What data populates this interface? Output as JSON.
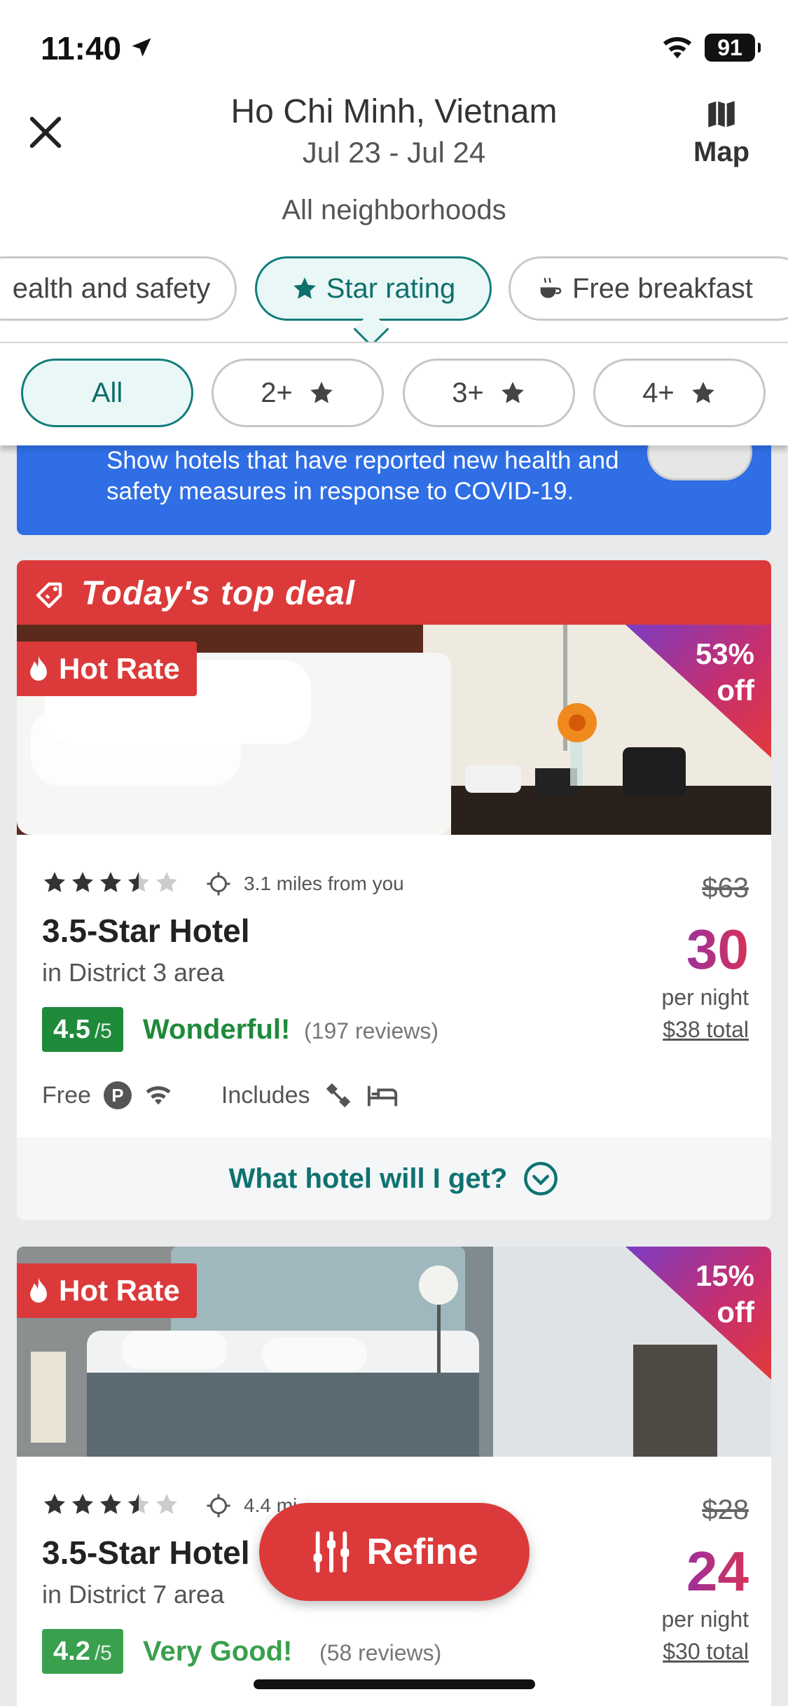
{
  "status_bar": {
    "time": "11:40",
    "battery": "91"
  },
  "header": {
    "destination": "Ho Chi Minh, Vietnam",
    "dates": "Jul 23 - Jul 24",
    "map_label": "Map",
    "neighborhoods": "All neighborhoods"
  },
  "filter_chips": [
    "ealth and safety",
    "Star rating",
    "Free breakfast"
  ],
  "star_filters": [
    {
      "label": "All"
    },
    {
      "label": "2+"
    },
    {
      "label": "3+"
    },
    {
      "label": "4+"
    }
  ],
  "covid_banner": {
    "text": "Show hotels that have reported new health and safety measures in response to COVID-19."
  },
  "top_deal_label": "Today's top deal",
  "hot_rate_label": "Hot Rate",
  "refine_label": "Refine",
  "what_hotel_label": "What hotel will I get?",
  "hotels": [
    {
      "discount": "53%",
      "off": "off",
      "stars": 3.5,
      "distance": "3.1 miles from you",
      "name": "3.5-Star Hotel",
      "area": "in District 3 area",
      "rating": "4.5",
      "rating_of": "/5",
      "verdict": "Wonderful!",
      "reviews": "(197 reviews)",
      "old_price": "$63",
      "currency": "$",
      "price": "30",
      "per_night": "per night",
      "total": "$38 total",
      "amenity_free": "Free",
      "amenity_includes": "Includes"
    },
    {
      "discount": "15%",
      "off": "off",
      "stars": 3.5,
      "distance": "4.4 mi",
      "name": "3.5-Star Hotel",
      "area": "in District 7 area",
      "rating": "4.2",
      "rating_of": "/5",
      "verdict": "Very Good!",
      "reviews": "(58 reviews)",
      "old_price": "$28",
      "currency": "$",
      "price": "24",
      "per_night": "per night",
      "total": "$30 total"
    }
  ],
  "colors": {
    "accent_teal": "#127d7a",
    "deal_red": "#dc3a3a",
    "covid_blue": "#2f6ee5",
    "rating_green": "#1e8a3a"
  }
}
